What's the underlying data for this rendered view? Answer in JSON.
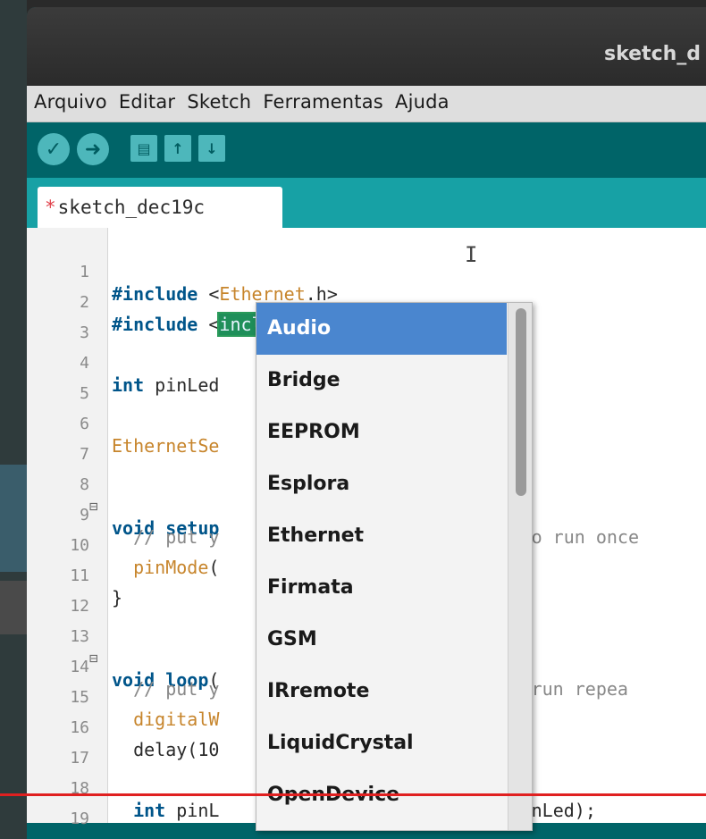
{
  "window": {
    "title": "sketch_d"
  },
  "menubar": {
    "items": [
      "Arquivo",
      "Editar",
      "Sketch",
      "Ferramentas",
      "Ajuda"
    ]
  },
  "toolbar": {
    "buttons": [
      {
        "icon": "check-icon",
        "glyph": "✓"
      },
      {
        "icon": "arrow-right-icon",
        "glyph": "➜"
      },
      {
        "icon": "new-file-icon",
        "glyph": "▤"
      },
      {
        "icon": "open-icon",
        "glyph": "↑"
      },
      {
        "icon": "save-icon",
        "glyph": "↓"
      }
    ]
  },
  "tab": {
    "modified_marker": "*",
    "label": "sketch_dec19c"
  },
  "editor": {
    "lines": [
      {
        "n": "1",
        "fold": "",
        "text": "#include <Ethernet.h>"
      },
      {
        "n": "2",
        "fold": "",
        "text": "#include <include.h>"
      },
      {
        "n": "3",
        "fold": "",
        "text": ""
      },
      {
        "n": "4",
        "fold": "",
        "text": "int pinLed"
      },
      {
        "n": "5",
        "fold": "",
        "text": ""
      },
      {
        "n": "6",
        "fold": "",
        "text": "EthernetSe"
      },
      {
        "n": "7",
        "fold": "",
        "text": ""
      },
      {
        "n": "8",
        "fold": "⊟",
        "text": "void setup"
      },
      {
        "n": "9",
        "fold": "",
        "text": "  // put y                          , to run once"
      },
      {
        "n": "10",
        "fold": "",
        "text": "  pinMode("
      },
      {
        "n": "11",
        "fold": "",
        "text": "}"
      },
      {
        "n": "12",
        "fold": "",
        "text": ""
      },
      {
        "n": "13",
        "fold": "⊟",
        "text": "void loop("
      },
      {
        "n": "14",
        "fold": "",
        "text": "  // put y                          to run repea"
      },
      {
        "n": "15",
        "fold": "",
        "text": "  digitalW"
      },
      {
        "n": "16",
        "fold": "",
        "text": "  delay(10"
      },
      {
        "n": "17",
        "fold": "",
        "text": ""
      },
      {
        "n": "18",
        "fold": "",
        "text": "  int pinL                          (pinLed);"
      },
      {
        "n": "19",
        "fold": "",
        "text": ""
      }
    ]
  },
  "autocomplete": {
    "items": [
      "Audio",
      "Bridge",
      "EEPROM",
      "Esplora",
      "Ethernet",
      "Firmata",
      "GSM",
      "IRremote",
      "LiquidCrystal",
      "OpenDevice"
    ],
    "selected": "Audio"
  },
  "colors": {
    "accent": "#006468",
    "tab_strip": "#17a1a5",
    "selection": "#4a86cf",
    "overlay_line": "#e02020"
  }
}
